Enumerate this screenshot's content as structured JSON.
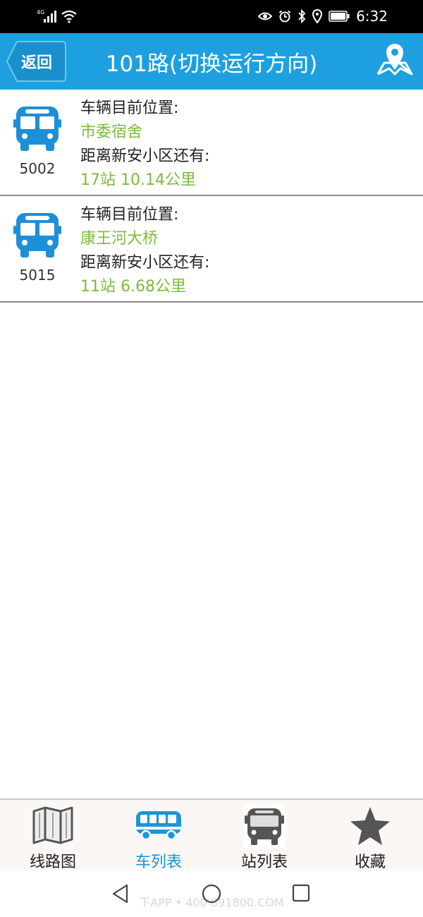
{
  "status_bar": {
    "network": "4G",
    "time": "6:32"
  },
  "header": {
    "back_label": "返回",
    "title": "101路(切换运行方向)"
  },
  "buses": [
    {
      "number": "5002",
      "position_label": "车辆目前位置:",
      "position": "市委宿舍",
      "distance_label": "距离新安小区还有:",
      "distance": "17站  10.14公里"
    },
    {
      "number": "5015",
      "position_label": "车辆目前位置:",
      "position": "康王河大桥",
      "distance_label": "距离新安小区还有:",
      "distance": "11站  6.68公里"
    }
  ],
  "tabs": [
    {
      "label": "线路图",
      "icon": "map-icon",
      "active": false
    },
    {
      "label": "车列表",
      "icon": "bus-icon",
      "active": true
    },
    {
      "label": "站列表",
      "icon": "bus-front-icon",
      "active": false
    },
    {
      "label": "收藏",
      "icon": "star-icon",
      "active": false
    }
  ],
  "nav_bar": {
    "watermark": "下APP • 400 891800.COM"
  },
  "colors": {
    "header_bg": "#1ea0e0",
    "accent_green": "#7cbb3b",
    "bus_icon_blue": "#1d8fd8",
    "active_tab": "#1a95d8"
  }
}
